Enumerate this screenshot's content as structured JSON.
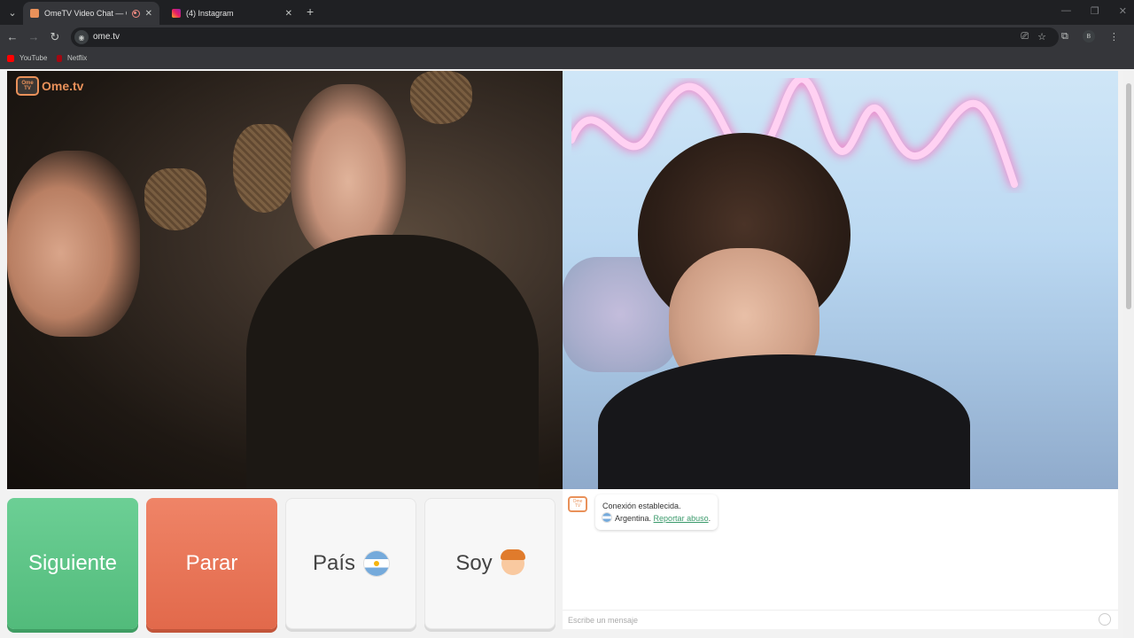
{
  "browser": {
    "tabs": [
      {
        "title": "OmeTV Video Chat — Ome",
        "active": true
      },
      {
        "title": "(4) Instagram",
        "active": false
      }
    ],
    "url": "ome.tv",
    "profile_initial": "B",
    "bookmarks": [
      {
        "label": "YouTube",
        "color": "#ff0000"
      },
      {
        "label": "Netflix",
        "color": "#e50914"
      }
    ]
  },
  "app": {
    "logo_text": "Ome.tv",
    "logo_tv_text": "Ome TV",
    "buttons": {
      "next": "Siguiente",
      "stop": "Parar",
      "country": "País",
      "gender": "Soy"
    },
    "chat": {
      "status_line": "Conexión establecida.",
      "country": "Argentina.",
      "report_link": "Reportar abuso",
      "report_suffix": ".",
      "input_placeholder": "Escribe un mensaje"
    }
  },
  "colors": {
    "next_button": "#5ec487",
    "stop_button": "#e8765a",
    "brand_orange": "#e9915a",
    "link_green": "#3a9a6b"
  }
}
